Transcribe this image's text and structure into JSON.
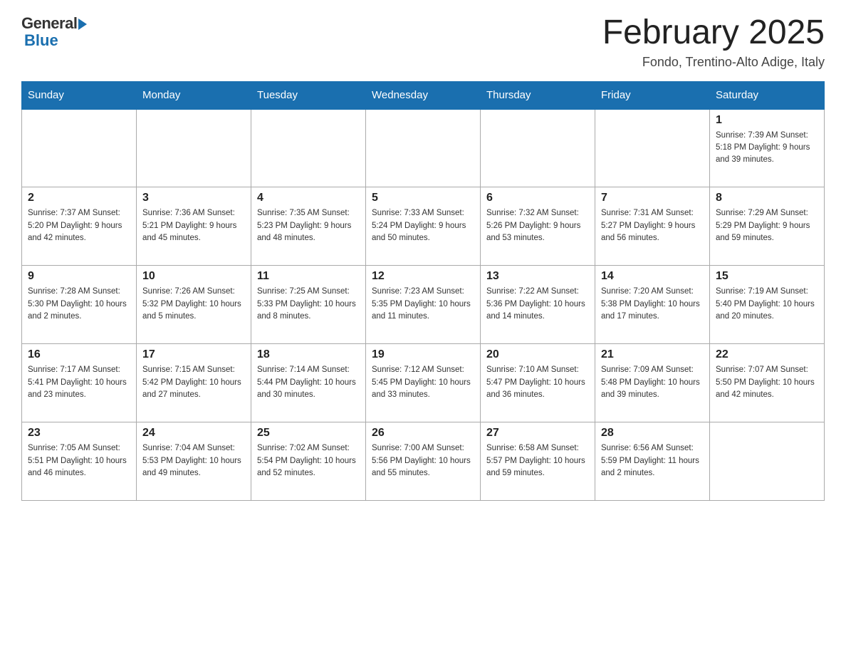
{
  "header": {
    "logo_general": "General",
    "logo_blue": "Blue",
    "month_title": "February 2025",
    "location": "Fondo, Trentino-Alto Adige, Italy"
  },
  "weekdays": [
    "Sunday",
    "Monday",
    "Tuesday",
    "Wednesday",
    "Thursday",
    "Friday",
    "Saturday"
  ],
  "weeks": [
    [
      {
        "day": "",
        "info": ""
      },
      {
        "day": "",
        "info": ""
      },
      {
        "day": "",
        "info": ""
      },
      {
        "day": "",
        "info": ""
      },
      {
        "day": "",
        "info": ""
      },
      {
        "day": "",
        "info": ""
      },
      {
        "day": "1",
        "info": "Sunrise: 7:39 AM\nSunset: 5:18 PM\nDaylight: 9 hours and 39 minutes."
      }
    ],
    [
      {
        "day": "2",
        "info": "Sunrise: 7:37 AM\nSunset: 5:20 PM\nDaylight: 9 hours and 42 minutes."
      },
      {
        "day": "3",
        "info": "Sunrise: 7:36 AM\nSunset: 5:21 PM\nDaylight: 9 hours and 45 minutes."
      },
      {
        "day": "4",
        "info": "Sunrise: 7:35 AM\nSunset: 5:23 PM\nDaylight: 9 hours and 48 minutes."
      },
      {
        "day": "5",
        "info": "Sunrise: 7:33 AM\nSunset: 5:24 PM\nDaylight: 9 hours and 50 minutes."
      },
      {
        "day": "6",
        "info": "Sunrise: 7:32 AM\nSunset: 5:26 PM\nDaylight: 9 hours and 53 minutes."
      },
      {
        "day": "7",
        "info": "Sunrise: 7:31 AM\nSunset: 5:27 PM\nDaylight: 9 hours and 56 minutes."
      },
      {
        "day": "8",
        "info": "Sunrise: 7:29 AM\nSunset: 5:29 PM\nDaylight: 9 hours and 59 minutes."
      }
    ],
    [
      {
        "day": "9",
        "info": "Sunrise: 7:28 AM\nSunset: 5:30 PM\nDaylight: 10 hours and 2 minutes."
      },
      {
        "day": "10",
        "info": "Sunrise: 7:26 AM\nSunset: 5:32 PM\nDaylight: 10 hours and 5 minutes."
      },
      {
        "day": "11",
        "info": "Sunrise: 7:25 AM\nSunset: 5:33 PM\nDaylight: 10 hours and 8 minutes."
      },
      {
        "day": "12",
        "info": "Sunrise: 7:23 AM\nSunset: 5:35 PM\nDaylight: 10 hours and 11 minutes."
      },
      {
        "day": "13",
        "info": "Sunrise: 7:22 AM\nSunset: 5:36 PM\nDaylight: 10 hours and 14 minutes."
      },
      {
        "day": "14",
        "info": "Sunrise: 7:20 AM\nSunset: 5:38 PM\nDaylight: 10 hours and 17 minutes."
      },
      {
        "day": "15",
        "info": "Sunrise: 7:19 AM\nSunset: 5:40 PM\nDaylight: 10 hours and 20 minutes."
      }
    ],
    [
      {
        "day": "16",
        "info": "Sunrise: 7:17 AM\nSunset: 5:41 PM\nDaylight: 10 hours and 23 minutes."
      },
      {
        "day": "17",
        "info": "Sunrise: 7:15 AM\nSunset: 5:42 PM\nDaylight: 10 hours and 27 minutes."
      },
      {
        "day": "18",
        "info": "Sunrise: 7:14 AM\nSunset: 5:44 PM\nDaylight: 10 hours and 30 minutes."
      },
      {
        "day": "19",
        "info": "Sunrise: 7:12 AM\nSunset: 5:45 PM\nDaylight: 10 hours and 33 minutes."
      },
      {
        "day": "20",
        "info": "Sunrise: 7:10 AM\nSunset: 5:47 PM\nDaylight: 10 hours and 36 minutes."
      },
      {
        "day": "21",
        "info": "Sunrise: 7:09 AM\nSunset: 5:48 PM\nDaylight: 10 hours and 39 minutes."
      },
      {
        "day": "22",
        "info": "Sunrise: 7:07 AM\nSunset: 5:50 PM\nDaylight: 10 hours and 42 minutes."
      }
    ],
    [
      {
        "day": "23",
        "info": "Sunrise: 7:05 AM\nSunset: 5:51 PM\nDaylight: 10 hours and 46 minutes."
      },
      {
        "day": "24",
        "info": "Sunrise: 7:04 AM\nSunset: 5:53 PM\nDaylight: 10 hours and 49 minutes."
      },
      {
        "day": "25",
        "info": "Sunrise: 7:02 AM\nSunset: 5:54 PM\nDaylight: 10 hours and 52 minutes."
      },
      {
        "day": "26",
        "info": "Sunrise: 7:00 AM\nSunset: 5:56 PM\nDaylight: 10 hours and 55 minutes."
      },
      {
        "day": "27",
        "info": "Sunrise: 6:58 AM\nSunset: 5:57 PM\nDaylight: 10 hours and 59 minutes."
      },
      {
        "day": "28",
        "info": "Sunrise: 6:56 AM\nSunset: 5:59 PM\nDaylight: 11 hours and 2 minutes."
      },
      {
        "day": "",
        "info": ""
      }
    ]
  ]
}
